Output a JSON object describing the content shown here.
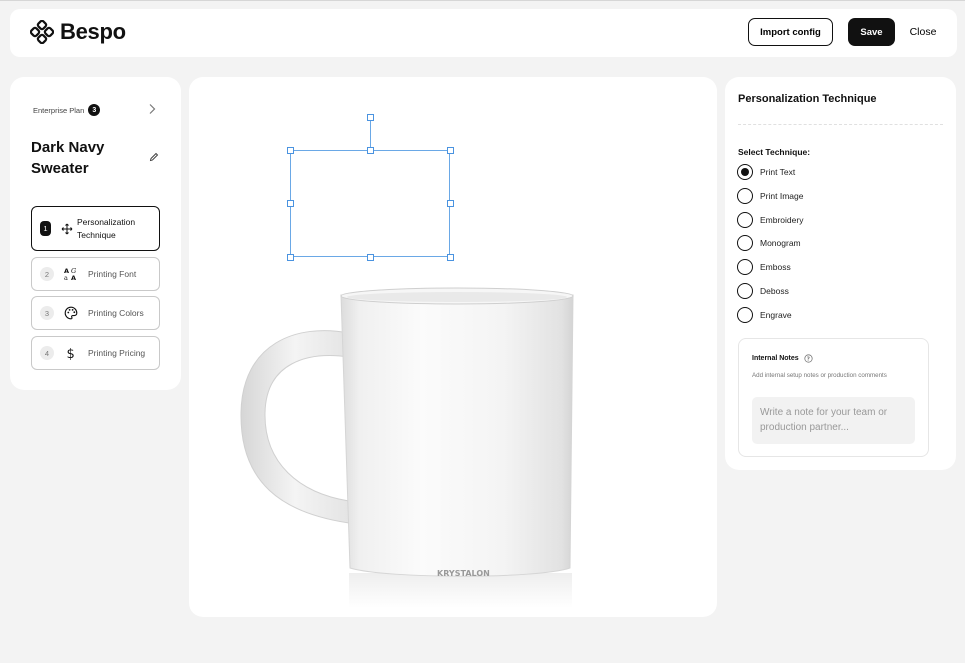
{
  "header": {
    "brand": "Bespo",
    "import_label": "Import config",
    "save_label": "Save",
    "close_label": "Close"
  },
  "sidebar": {
    "plan_label": "Enterprise Plan",
    "plan_badge": "3",
    "product_title": "Dark Navy Sweater",
    "steps": [
      {
        "num": "1",
        "label": "Personalization Technique",
        "icon": "move-icon",
        "active": true
      },
      {
        "num": "2",
        "label": "Printing Font",
        "icon": "font-icon",
        "active": false
      },
      {
        "num": "3",
        "label": "Printing Colors",
        "icon": "palette-icon",
        "active": false
      },
      {
        "num": "4",
        "label": "Printing Pricing",
        "icon": "dollar-icon",
        "active": false
      }
    ]
  },
  "canvas": {
    "mug_brand": "KRYSTALON"
  },
  "technique_panel": {
    "title": "Personalization Technique",
    "select_label": "Select Technique:",
    "options": [
      {
        "label": "Print Text",
        "checked": true
      },
      {
        "label": "Print Image",
        "checked": false
      },
      {
        "label": "Embroidery",
        "checked": false
      },
      {
        "label": "Monogram",
        "checked": false
      },
      {
        "label": "Emboss",
        "checked": false
      },
      {
        "label": "Deboss",
        "checked": false
      },
      {
        "label": "Engrave",
        "checked": false
      }
    ],
    "notes": {
      "title": "Internal Notes",
      "subtitle": "Add internal setup notes or production comments",
      "placeholder": "Write a note for your team or production partner..."
    }
  }
}
